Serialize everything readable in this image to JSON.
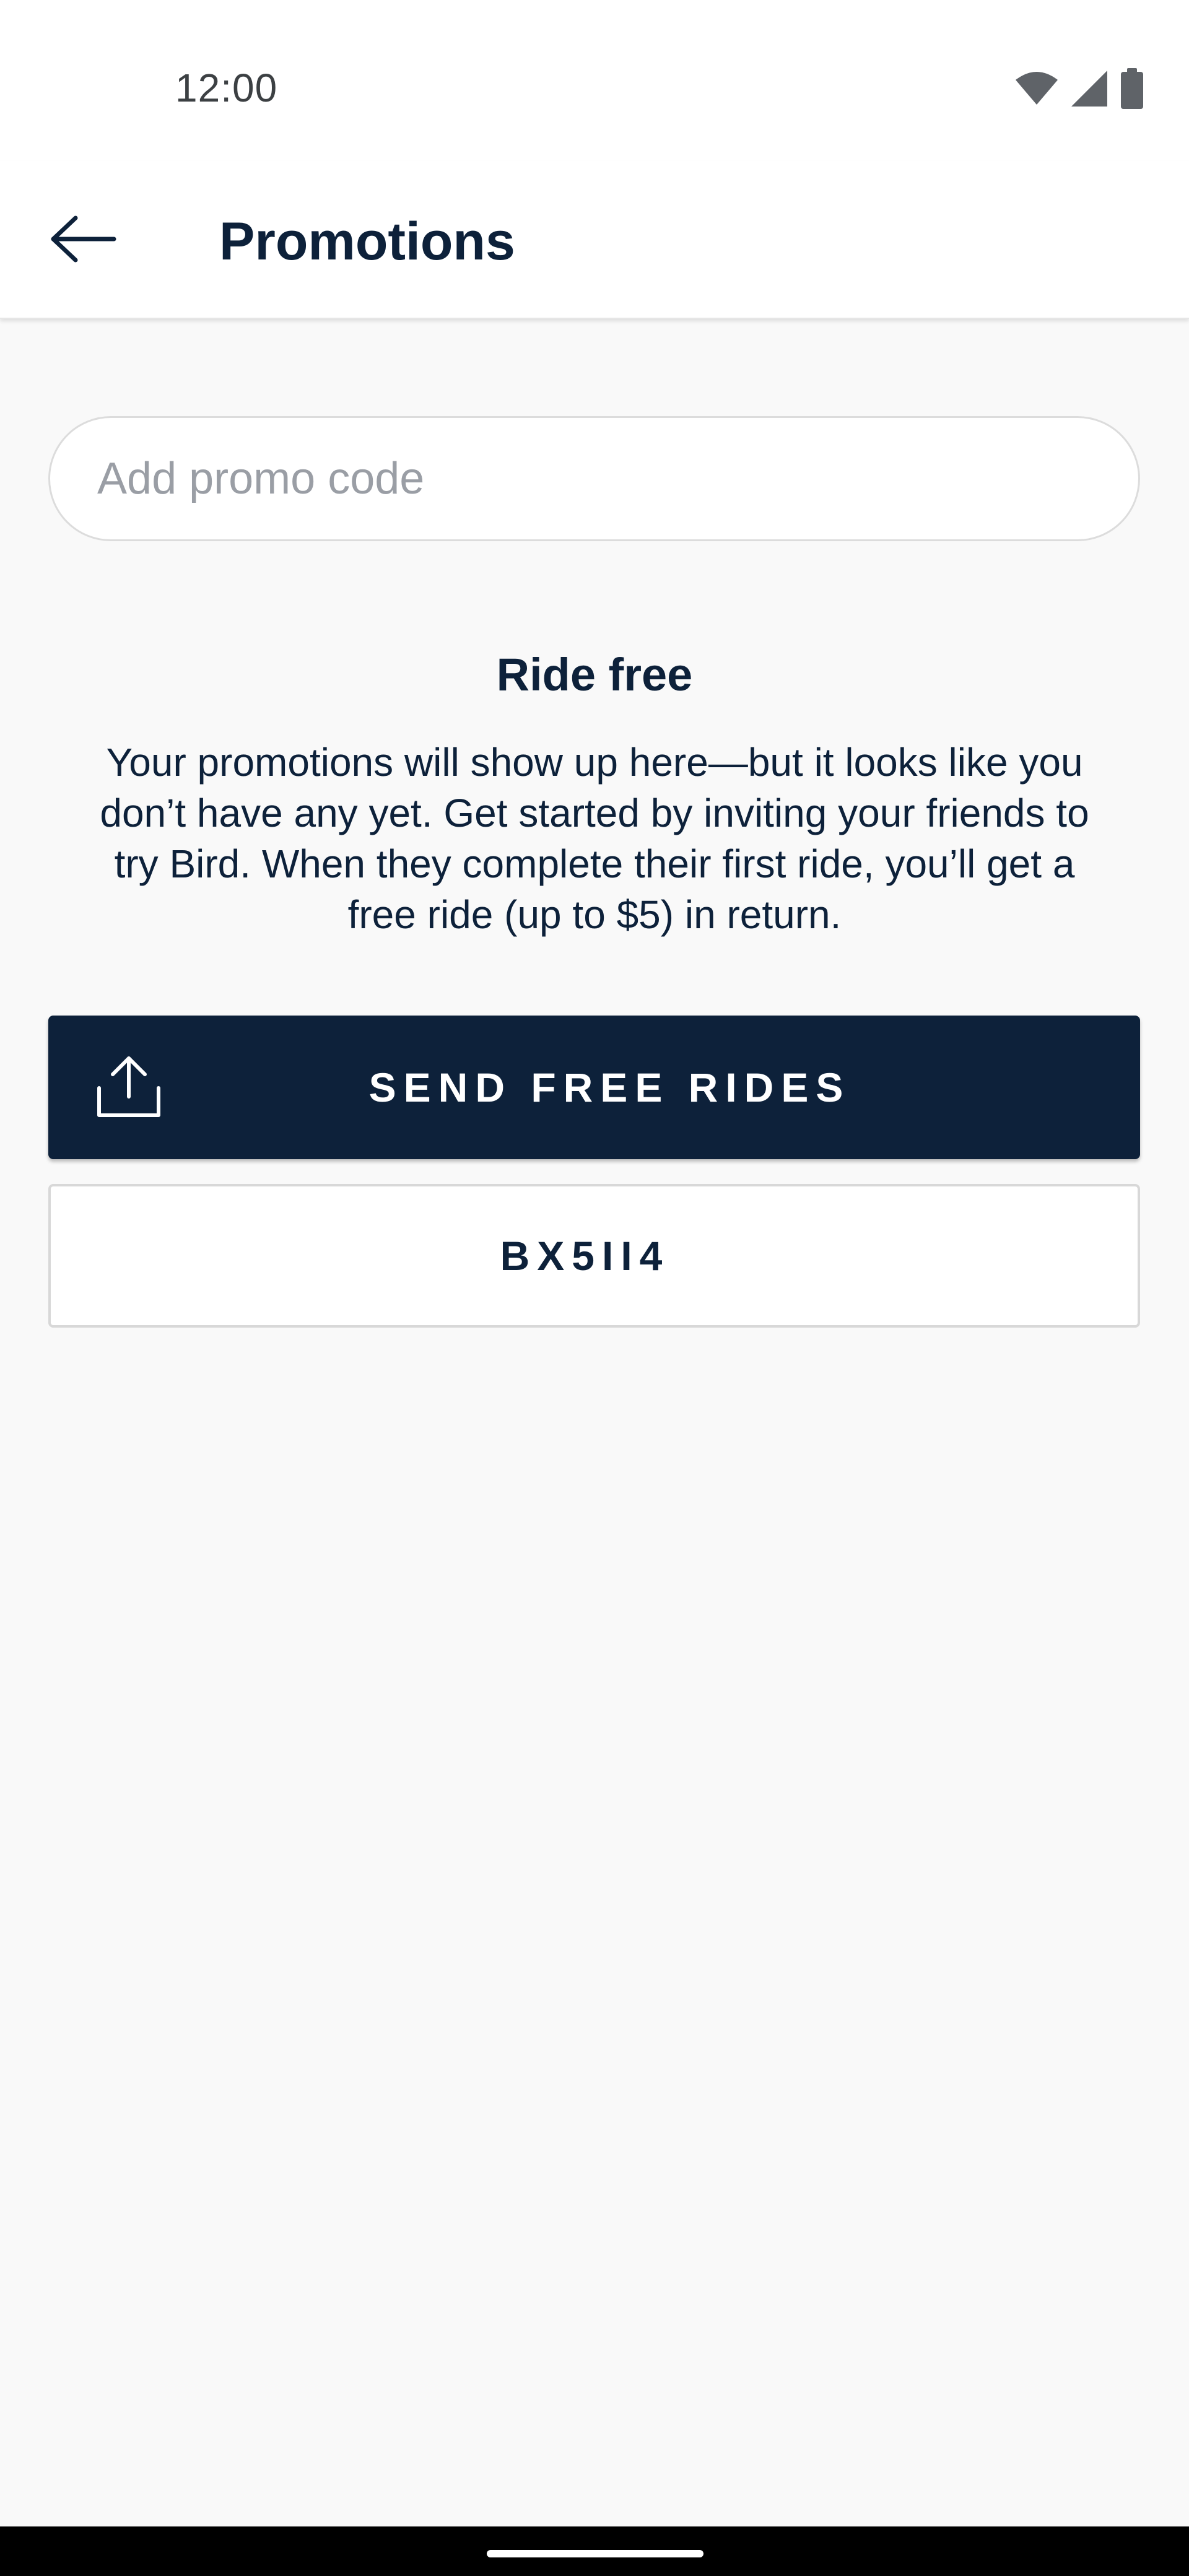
{
  "status_bar": {
    "time": "12:00",
    "icons": [
      "wifi-icon",
      "signal-icon",
      "battery-icon"
    ]
  },
  "app_bar": {
    "back_icon": "arrow-left-icon",
    "title": "Promotions"
  },
  "promo": {
    "placeholder": "Add promo code",
    "value": ""
  },
  "empty_state": {
    "title": "Ride free",
    "body": "Your promotions will show up here—but it looks like you don’t have any yet. Get started by inviting your friends to try Bird. When they complete their first ride, you’ll get a free ride (up to $5) in return."
  },
  "actions": {
    "share_icon": "share-upload-icon",
    "send_label": "SEND FREE RIDES",
    "referral_code": "BX5II4"
  },
  "colors": {
    "primary": "#0d213a",
    "background": "#f9f9f9",
    "surface": "#ffffff",
    "placeholder": "#9a9ea5",
    "border": "#dcdcdc"
  }
}
